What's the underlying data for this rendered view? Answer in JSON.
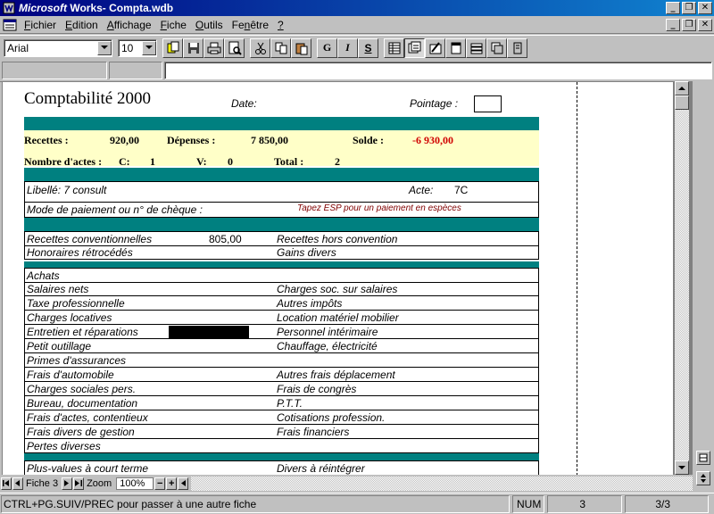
{
  "window": {
    "title_brand": "Microsoft",
    "title_rest": " Works- Compta.wdb",
    "min_glyph": "_",
    "max_glyph": "❐",
    "close_glyph": "✕"
  },
  "menu": [
    "Fichier",
    "Edition",
    "Affichage",
    "Fiche",
    "Outils",
    "Fenêtre",
    "?"
  ],
  "menu_underline": [
    "F",
    "E",
    "A",
    "F",
    "O",
    "n",
    "?"
  ],
  "toolbar": {
    "font_name": "Arial",
    "font_size": "10",
    "bold_label": "G",
    "italic_label": "I",
    "underline_label": "S"
  },
  "form": {
    "title": "Comptabilité  2000",
    "date_label": "Date:",
    "pointage_label": "Pointage :",
    "recettes_label": "Recettes :",
    "recettes_value": "920,00",
    "depenses_label": "Dépenses :",
    "depenses_value": "7 850,00",
    "solde_label": "Solde :",
    "solde_value": "-6 930,00",
    "actes_label": "Nombre d'actes :",
    "c_label": "C:",
    "c_value": "1",
    "v_label": "V:",
    "v_value": "0",
    "total_label": "Total :",
    "total_value": "2",
    "libelle": "Libellé: 7 consult",
    "acte_label": "Acte:",
    "acte_value": "7C",
    "paiement_label": "Mode de paiement ou n° de chèque :",
    "esp_hint": "Tapez ESP pour un paiement en espèces",
    "rows1": [
      {
        "left": "Recettes conventionnelles",
        "num": "805,00",
        "right": "Recettes hors convention"
      },
      {
        "left": "Honoraires rétrocédés",
        "num": "",
        "right": "Gains divers"
      }
    ],
    "rows2": [
      {
        "left": "Achats",
        "right": ""
      },
      {
        "left": "Salaires nets",
        "right": "Charges soc. sur salaires"
      },
      {
        "left": "Taxe professionnelle",
        "right": "Autres impôts"
      },
      {
        "left": "Charges locatives",
        "right": "Location matériel mobilier"
      },
      {
        "left": "Entretien et réparations",
        "right": "Personnel intérimaire"
      },
      {
        "left": "Petit outillage",
        "right": "Chauffage, électricité"
      },
      {
        "left": "Primes d'assurances",
        "right": ""
      },
      {
        "left": "Frais d'automobile",
        "right": "Autres frais déplacement"
      },
      {
        "left": "Charges sociales pers.",
        "right": "Frais de congrès"
      },
      {
        "left": "Bureau, documentation",
        "right": "P.T.T."
      },
      {
        "left": "Frais d'actes, contentieux",
        "right": "Cotisations profession."
      },
      {
        "left": "Frais divers de gestion",
        "right": "Frais financiers"
      },
      {
        "left": "Pertes diverses",
        "right": ""
      }
    ],
    "rows3": [
      {
        "left": "Plus-values à court terme",
        "right": "Divers à réintégrer"
      }
    ]
  },
  "navigation": {
    "record_label": "Fiche 3",
    "zoom_label": "Zoom",
    "zoom_value": "100%",
    "minus": "−",
    "plus": "+"
  },
  "status": {
    "message": "CTRL+PG.SUIV/PREC pour passer à une autre fiche",
    "num": "NUM",
    "record": "3",
    "count": "3/3"
  },
  "colors": {
    "teal": "#008080",
    "yellow": "#ffffc8",
    "negative": "#d00000",
    "hint": "#800000"
  }
}
